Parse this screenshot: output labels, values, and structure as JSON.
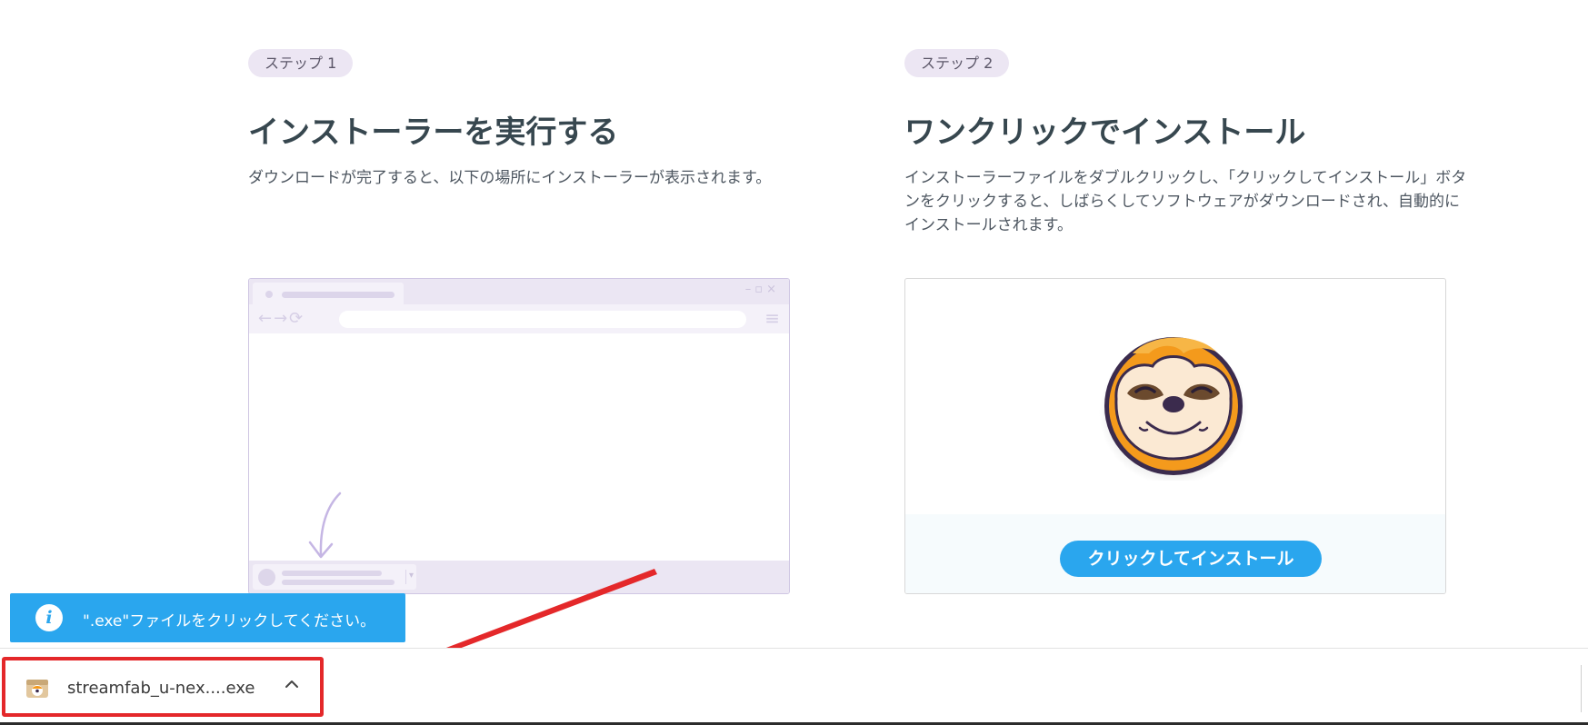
{
  "step1": {
    "badge": "ステップ 1",
    "title": "インストーラーを実行する",
    "description": "ダウンロードが完了すると、以下の場所にインストーラーが表示されます。"
  },
  "step2": {
    "badge": "ステップ 2",
    "title": "ワンクリックでインストール",
    "description": "インストーラーファイルをダブルクリックし、「クリックしてインストール」ボタンをクリックすると、しばらくしてソフトウェアがダウンロードされ、自動的にインストールされます。",
    "install_button": "クリックしてインストール"
  },
  "tooltip": {
    "icon": "info-icon",
    "text": "\".exe\"ファイルをクリックしてください。"
  },
  "download_shelf": {
    "file_name": "streamfab_u-nex....exe",
    "file_icon": "installer-package-icon",
    "menu_icon": "chevron-up-icon"
  },
  "colors": {
    "accent_blue": "#2aa6ee",
    "highlight_red": "#e4282a",
    "badge_bg": "#ece6f3",
    "title_color": "#37474f",
    "sloth_orange": "#f49a1c"
  }
}
